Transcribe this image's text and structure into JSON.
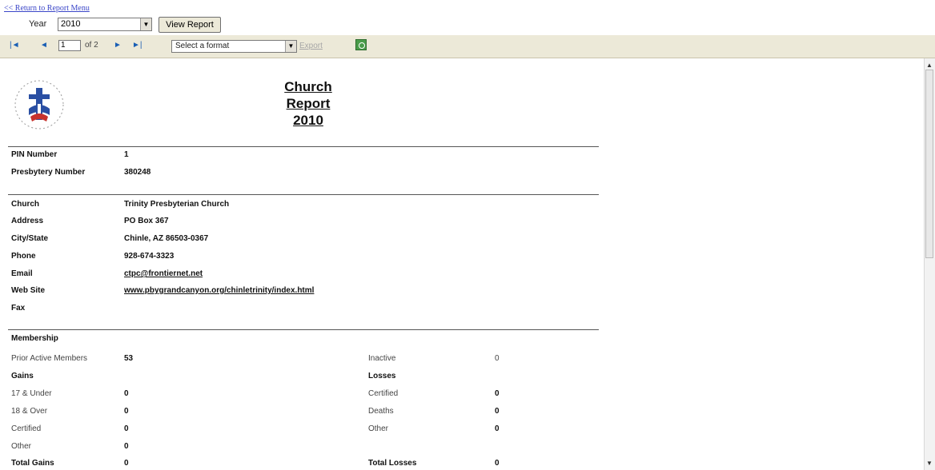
{
  "header": {
    "return_link": "<< Return to Report Menu",
    "year_label": "Year",
    "year_value": "2010",
    "view_report": "View Report"
  },
  "toolbar": {
    "first_icon": "first-page-icon",
    "prev_icon": "prev-page-icon",
    "page_value": "1",
    "of_pages": "of 2",
    "next_icon": "next-page-icon",
    "last_icon": "last-page-icon",
    "format_placeholder": "Select a format",
    "export_label": "Export",
    "refresh_icon": "refresh-icon"
  },
  "report": {
    "title_line1": "Church",
    "title_line2": "Report",
    "title_line3": "2010",
    "logo_text": "PRESBYTERIAN CHURCH",
    "pin_label": "PIN Number",
    "pin_value": "1",
    "presbytery_label": "Presbytery Number",
    "presbytery_value": "380248",
    "church_label": "Church",
    "church_value": "Trinity Presbyterian Church",
    "address_label": "Address",
    "address_value": "PO Box 367",
    "citystate_label": "City/State",
    "citystate_value": "Chinle, AZ 86503-0367",
    "phone_label": "Phone",
    "phone_value": "928-674-3323",
    "email_label": "Email",
    "email_value": "ctpc@frontiernet.net",
    "website_label": "Web Site",
    "website_value": "www.pbygrandcanyon.org/chinletrinity/index.html",
    "fax_label": "Fax",
    "membership_label": "Membership",
    "prior_active_label": "Prior Active Members",
    "prior_active_value": "53",
    "inactive_label": "Inactive",
    "inactive_value": "0",
    "gains_label": "Gains",
    "losses_label": "Losses",
    "under17_label": "17 & Under",
    "under17_value": "0",
    "over18_label": "18 & Over",
    "over18_value": "0",
    "certified_gain_label": "Certified",
    "certified_gain_value": "0",
    "other_gain_label": "Other",
    "other_gain_value": "0",
    "total_gains_label": "Total Gains",
    "total_gains_value": "0",
    "certified_loss_label": "Certified",
    "certified_loss_value": "0",
    "deaths_label": "Deaths",
    "deaths_value": "0",
    "other_loss_label": "Other",
    "other_loss_value": "0",
    "total_losses_label": "Total Losses",
    "total_losses_value": "0"
  }
}
